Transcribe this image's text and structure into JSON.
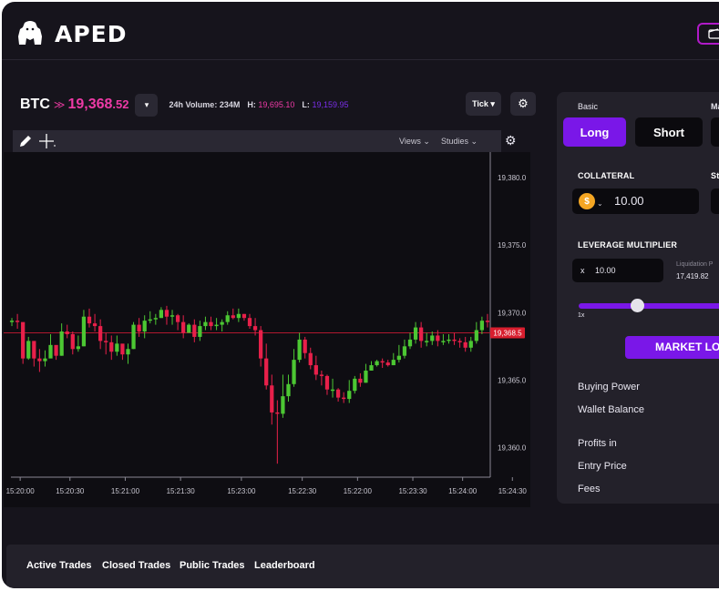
{
  "brand": {
    "name": "APED",
    "icon": "gorilla-icon"
  },
  "ticker": {
    "symbol": "BTC",
    "trend_icon": "double-chevron-down-icon",
    "price_main": "19,368",
    "price_decimals": ".52",
    "dropdown_glyph": "▾",
    "volume_label": "24h Volume:",
    "volume_value": "234M",
    "high_label": "H:",
    "high_value": "19,695.10",
    "low_label": "L:",
    "low_value": "19,159.95",
    "tick_label": "Tick ▾"
  },
  "chart_toolbar": {
    "views_label": "Views ⌄",
    "studies_label": "Studies ⌄"
  },
  "chart_data": {
    "type": "candlestick",
    "xlabels": [
      "15:20:00",
      "15:20:30",
      "15:21:00",
      "15:21:30",
      "15:23:00",
      "15:22:30",
      "15:22:00",
      "15:23:30",
      "15:24:00",
      "15:24:30"
    ],
    "ylabels": [
      "19,380.0",
      "19,375.0",
      "19,370.0",
      "19,365.0",
      "19,360.0"
    ],
    "ylim": [
      19357.8,
      19381.9
    ],
    "current_price": 19368.5,
    "current_price_label": "19,368.5",
    "colors": {
      "up": "#4cc733",
      "down": "#e8204a",
      "price_line": "#b0182e"
    },
    "grid": false,
    "closes": [
      19369.4,
      19369.3,
      19366.6,
      19367.9,
      19366.6,
      19366.4,
      19366.6,
      19367.6,
      19366.8,
      19368.6,
      19368.4,
      19367.3,
      19367.5,
      19369.7,
      19369.2,
      19369.0,
      19367.9,
      19367.8,
      19367.1,
      19367.7,
      19366.9,
      19367.3,
      19369.1,
      19368.6,
      19369.4,
      19369.5,
      19369.6,
      19370.2,
      19369.7,
      19369.8,
      19369.3,
      19368.5,
      19369.1,
      19368.2,
      19369.0,
      19369.3,
      19369.0,
      19369.1,
      19369.3,
      19369.8,
      19369.6,
      19369.9,
      19369.6,
      19369.0,
      19368.7,
      19366.6,
      19364.6,
      19362.6,
      19362.5,
      19363.8,
      19364.7,
      19366.5,
      19368.0,
      19367.0,
      19366.1,
      19365.4,
      19365.3,
      19364.3,
      19364.3,
      19363.7,
      19363.6,
      19364.2,
      19365.1,
      19364.8,
      19365.7,
      19366.1,
      19366.4,
      19366.3,
      19366.1,
      19366.5,
      19366.8,
      19367.5,
      19368.0,
      19368.9,
      19367.9,
      19367.9,
      19368.3,
      19367.9,
      19367.9,
      19368.0,
      19367.9,
      19367.8,
      19367.4,
      19367.9,
      19368.7,
      19369.4,
      19369.3
    ],
    "highs": [
      19369.6,
      19369.9,
      19368.2,
      19368.2,
      19367.4,
      19367.3,
      19367.2,
      19368.4,
      19367.4,
      19369.2,
      19369.1,
      19368.6,
      19368.3,
      19370.2,
      19370.3,
      19369.9,
      19369.5,
      19368.5,
      19368.3,
      19368.3,
      19367.6,
      19367.7,
      19369.3,
      19369.6,
      19369.8,
      19370.1,
      19369.9,
      19370.4,
      19370.5,
      19370.2,
      19369.9,
      19369.8,
      19369.2,
      19369.5,
      19369.4,
      19369.7,
      19369.7,
      19369.6,
      19369.5,
      19370.1,
      19370.3,
      19370.3,
      19369.9,
      19369.9,
      19369.6,
      19369.0,
      19367.7,
      19365.4,
      19363.5,
      19365.4,
      19365.4,
      19367.3,
      19368.5,
      19368.2,
      19367.4,
      19366.8,
      19365.7,
      19365.4,
      19365.1,
      19364.4,
      19364.1,
      19365.0,
      19365.3,
      19365.5,
      19366.2,
      19366.4,
      19366.5,
      19366.6,
      19366.5,
      19367.0,
      19367.6,
      19368.0,
      19368.5,
      19369.3,
      19369.3,
      19368.5,
      19368.6,
      19368.7,
      19368.4,
      19368.4,
      19368.5,
      19368.1,
      19368.2,
      19368.2,
      19369.3,
      19369.7,
      19369.9
    ],
    "lows": [
      19369.0,
      19368.8,
      19366.2,
      19366.5,
      19366.0,
      19365.6,
      19366.0,
      19367.2,
      19366.5,
      19366.8,
      19368.1,
      19366.9,
      19367.1,
      19367.5,
      19368.9,
      19368.6,
      19367.3,
      19366.9,
      19366.5,
      19366.8,
      19366.5,
      19366.2,
      19367.3,
      19368.2,
      19368.1,
      19369.2,
      19369.1,
      19369.6,
      19369.1,
      19369.1,
      19368.7,
      19368.1,
      19368.6,
      19367.8,
      19367.9,
      19368.7,
      19368.7,
      19368.7,
      19368.6,
      19369.1,
      19369.5,
      19369.3,
      19369.4,
      19368.8,
      19368.3,
      19366.0,
      19364.3,
      19361.7,
      19358.8,
      19362.2,
      19363.4,
      19364.5,
      19366.3,
      19366.6,
      19365.8,
      19365.0,
      19364.6,
      19363.9,
      19363.7,
      19363.4,
      19363.3,
      19363.3,
      19364.0,
      19364.5,
      19364.8,
      19365.7,
      19366.0,
      19365.9,
      19366.0,
      19366.1,
      19366.3,
      19366.6,
      19367.3,
      19367.7,
      19367.4,
      19367.5,
      19367.6,
      19367.5,
      19367.6,
      19367.7,
      19367.6,
      19367.4,
      19367.1,
      19367.1,
      19367.7,
      19368.4,
      19368.9
    ]
  },
  "order_panel": {
    "tab_basic": "Basic",
    "tab_second": "Ma",
    "long_label": "Long",
    "short_label": "Short",
    "collateral_label": "COLLATERAL",
    "second_col_label": "St",
    "collateral_value": "10.00",
    "coin_icon": "usdc-coin-icon",
    "leverage_label": "LEVERAGE MULTIPLIER",
    "leverage_prefix": "x",
    "leverage_value": "10.00",
    "liquidation_label": "Liquidation P",
    "liquidation_value": "17,419.82",
    "slider_min_label": "1x",
    "leverage_level": 0.3,
    "market_button": "MARKET LONG",
    "rows": [
      "Buying Power",
      "Wallet Balance",
      "Profits in",
      "Entry Price",
      "Fees"
    ]
  },
  "bottom_tabs": [
    "Active Trades",
    "Closed Trades",
    "Public Trades",
    "Leaderboard"
  ],
  "colors": {
    "accent_purple": "#7a17e8",
    "price_pink": "#ee3aa6",
    "wallet_border": "#b01ac8",
    "background": "#16141c"
  }
}
